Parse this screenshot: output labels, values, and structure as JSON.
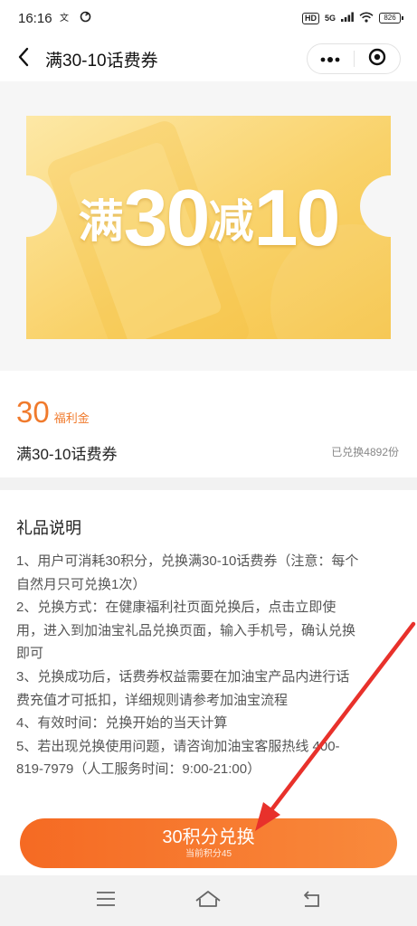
{
  "status_bar": {
    "time": "16:16",
    "left_icons": [
      "sms-icon",
      "sync-icon"
    ],
    "hd_badge": "HD",
    "network": "5G",
    "battery": "826"
  },
  "nav": {
    "title": "满30-10话费券"
  },
  "banner": {
    "prefix": "满",
    "threshold": "30",
    "middle": "减",
    "discount": "10",
    "colors": {
      "coupon_light": "#fde49a",
      "coupon_dark": "#f6c447"
    }
  },
  "info": {
    "points_value": "30",
    "points_unit": "福利金",
    "gift_name": "满30-10话费券",
    "redeemed_text": "已兑换4892份"
  },
  "description": {
    "title": "礼品说明",
    "lines": [
      "1、用户可消耗30积分，兑换满30-10话费券（注意：每个",
      "自然月只可兑换1次）",
      "2、兑换方式：在健康福利社页面兑换后，点击立即使",
      "用，进入到加油宝礼品兑换页面，输入手机号，确认兑换",
      "即可",
      "3、兑换成功后，话费券权益需要在加油宝产品内进行话",
      "费充值才可抵扣，详细规则请参考加油宝流程",
      "4、有效时间：兑换开始的当天计算",
      "5、若出现兑换使用问题，请咨询加油宝客服热线 400-",
      "819-7979（人工服务时间：9:00-21:00）"
    ]
  },
  "redeem": {
    "label": "30积分兑换",
    "sub_label": "当前积分45",
    "colors": {
      "start": "#f56a23",
      "end": "#f98a3c"
    }
  },
  "accent_color": "#f07a2c",
  "annotation_color": "#e8312b"
}
